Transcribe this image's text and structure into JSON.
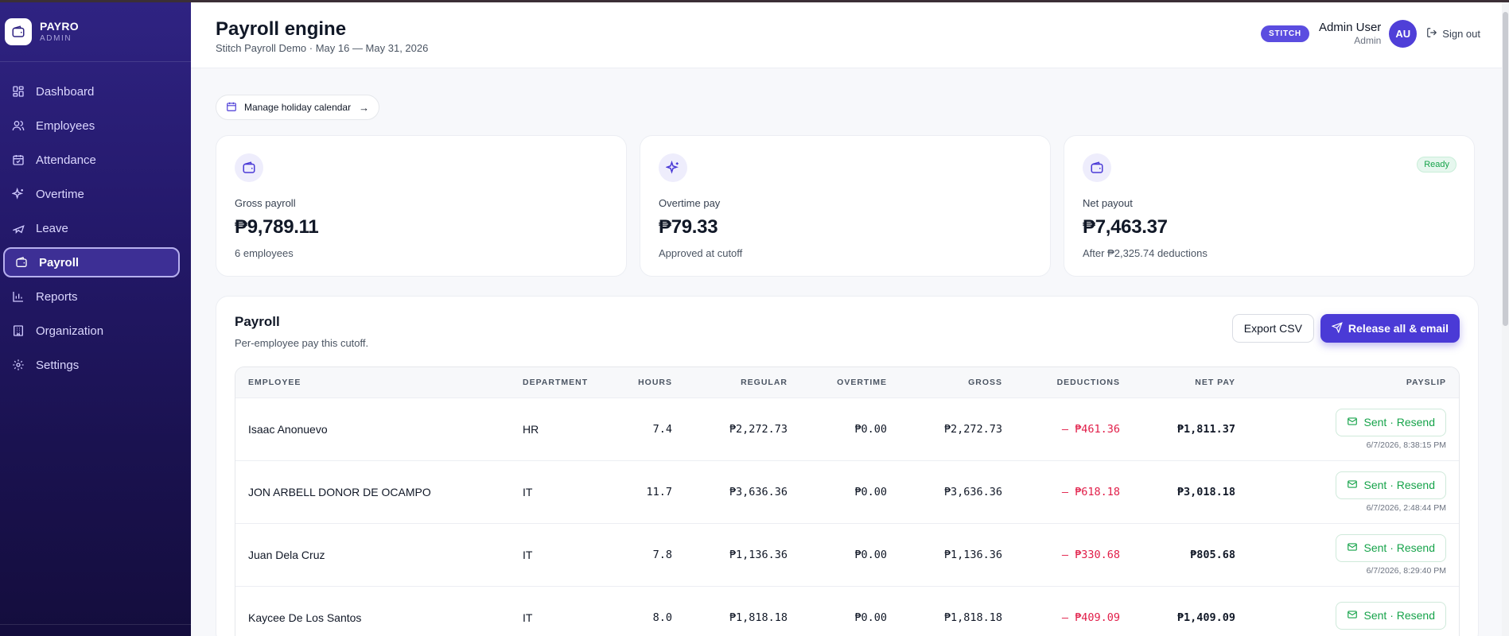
{
  "brand": {
    "name": "PAYRO",
    "sub": "ADMIN"
  },
  "sidebar": {
    "items": [
      {
        "label": "Dashboard",
        "icon": "dashboard-icon"
      },
      {
        "label": "Employees",
        "icon": "users-icon"
      },
      {
        "label": "Attendance",
        "icon": "calendar-check-icon"
      },
      {
        "label": "Overtime",
        "icon": "sparkles-icon"
      },
      {
        "label": "Leave",
        "icon": "plane-icon"
      },
      {
        "label": "Payroll",
        "icon": "wallet-icon",
        "active": true
      },
      {
        "label": "Reports",
        "icon": "bar-chart-icon"
      },
      {
        "label": "Organization",
        "icon": "building-icon"
      },
      {
        "label": "Settings",
        "icon": "gear-icon"
      }
    ]
  },
  "header": {
    "title": "Payroll engine",
    "subtitle": "Stitch Payroll Demo · May 16 — May 31, 2026",
    "tenant_badge": "STITCH",
    "user_name": "Admin User",
    "user_role": "Admin",
    "avatar_initials": "AU",
    "signout_label": "Sign out"
  },
  "holiday": {
    "label": "Manage holiday calendar",
    "arrow": "→"
  },
  "cards": [
    {
      "label": "Gross payroll",
      "value": "₱9,789.11",
      "note": "6 employees",
      "icon": "wallet-icon"
    },
    {
      "label": "Overtime pay",
      "value": "₱79.33",
      "note": "Approved at cutoff",
      "icon": "sparkles-icon"
    },
    {
      "label": "Net payout",
      "value": "₱7,463.37",
      "note": "After ₱2,325.74 deductions",
      "icon": "wallet-icon",
      "badge": "Ready"
    }
  ],
  "panel": {
    "title": "Payroll",
    "subtitle": "Per-employee pay this cutoff.",
    "export_label": "Export CSV",
    "release_label": "Release all & email"
  },
  "table": {
    "columns": [
      "Employee",
      "Department",
      "Hours",
      "Regular",
      "Overtime",
      "Gross",
      "Deductions",
      "Net pay",
      "Payslip"
    ],
    "rows": [
      {
        "employee": "Isaac Anonuevo",
        "department": "HR",
        "hours": "7.4",
        "regular": "₱2,272.73",
        "overtime": "₱0.00",
        "gross": "₱2,272.73",
        "deductions": "– ₱461.36",
        "net": "₱1,811.37",
        "payslip": "Sent · Resend",
        "sent_at": "6/7/2026, 8:38:15 PM"
      },
      {
        "employee": "JON ARBELL DONOR DE OCAMPO",
        "department": "IT",
        "hours": "11.7",
        "regular": "₱3,636.36",
        "overtime": "₱0.00",
        "gross": "₱3,636.36",
        "deductions": "– ₱618.18",
        "net": "₱3,018.18",
        "payslip": "Sent · Resend",
        "sent_at": "6/7/2026, 2:48:44 PM"
      },
      {
        "employee": "Juan Dela Cruz",
        "department": "IT",
        "hours": "7.8",
        "regular": "₱1,136.36",
        "overtime": "₱0.00",
        "gross": "₱1,136.36",
        "deductions": "– ₱330.68",
        "net": "₱805.68",
        "payslip": "Sent · Resend",
        "sent_at": "6/7/2026, 8:29:40 PM"
      },
      {
        "employee": "Kaycee De Los Santos",
        "department": "IT",
        "hours": "8.0",
        "regular": "₱1,818.18",
        "overtime": "₱0.00",
        "gross": "₱1,818.18",
        "deductions": "– ₱409.09",
        "net": "₱1,409.09",
        "payslip": "Sent · Resend",
        "sent_at": ""
      }
    ]
  },
  "colors": {
    "accent": "#4a3ad6",
    "sidebar": "#24196b",
    "success": "#16a34a",
    "danger": "#e11d48"
  }
}
